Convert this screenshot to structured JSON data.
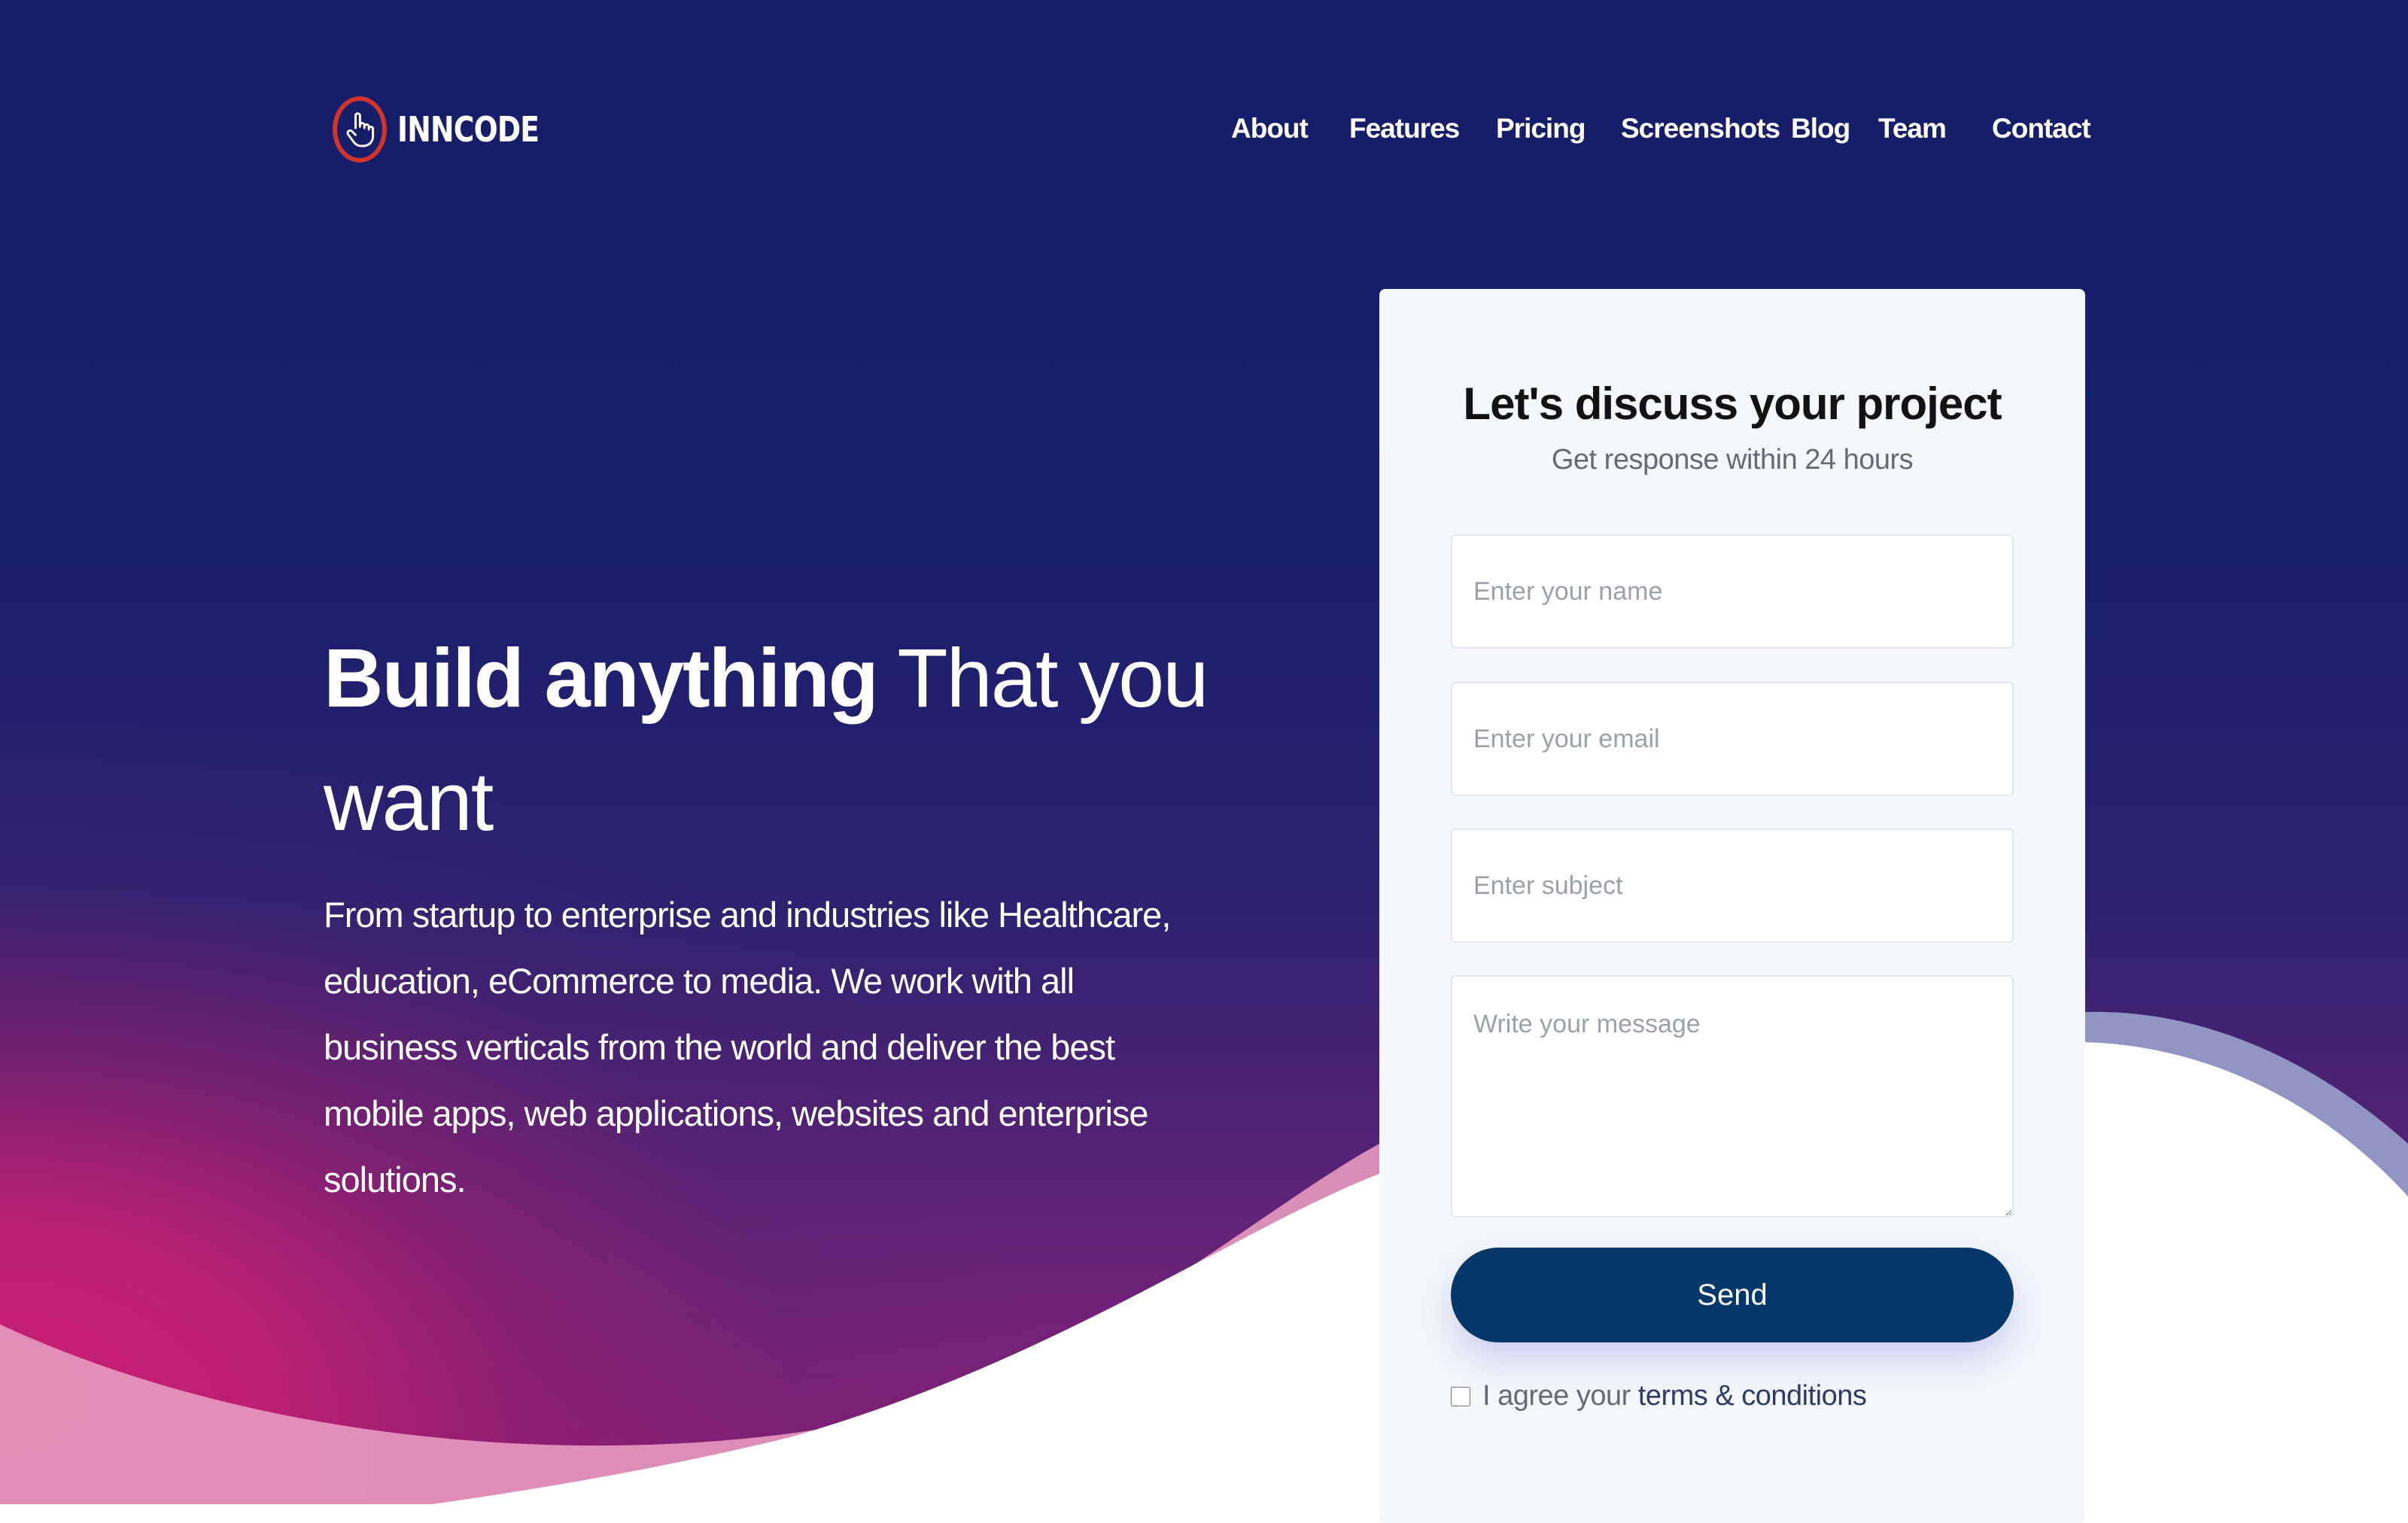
{
  "header": {
    "logo_text": "INNCODE",
    "nav": [
      "About",
      "Features",
      "Pricing",
      "Screenshots",
      "Blog",
      "Team",
      "Contact"
    ]
  },
  "hero": {
    "headline_bold": "Build anything",
    "headline_light": "That you want",
    "lead": "From startup to enterprise and industries like Healthcare, education, eCommerce to media. We work with all business verticals from the world and deliver the best mobile apps, web applications, websites and enterprise solutions."
  },
  "form": {
    "title": "Let's discuss your project",
    "subtitle": "Get response within 24 hours",
    "name_placeholder": "Enter your name",
    "email_placeholder": "Enter your email",
    "subject_placeholder": "Enter subject",
    "message_placeholder": "Write your message",
    "send_label": "Send",
    "agree_prefix": "I agree your",
    "terms_label": "terms & conditions"
  },
  "colors": {
    "hero_top": "#151e6a",
    "hero_pink": "#c81f74",
    "button": "#06376a",
    "logo_ring": "#d0342c"
  },
  "icons": {
    "logo": "pointer-hand-icon"
  }
}
